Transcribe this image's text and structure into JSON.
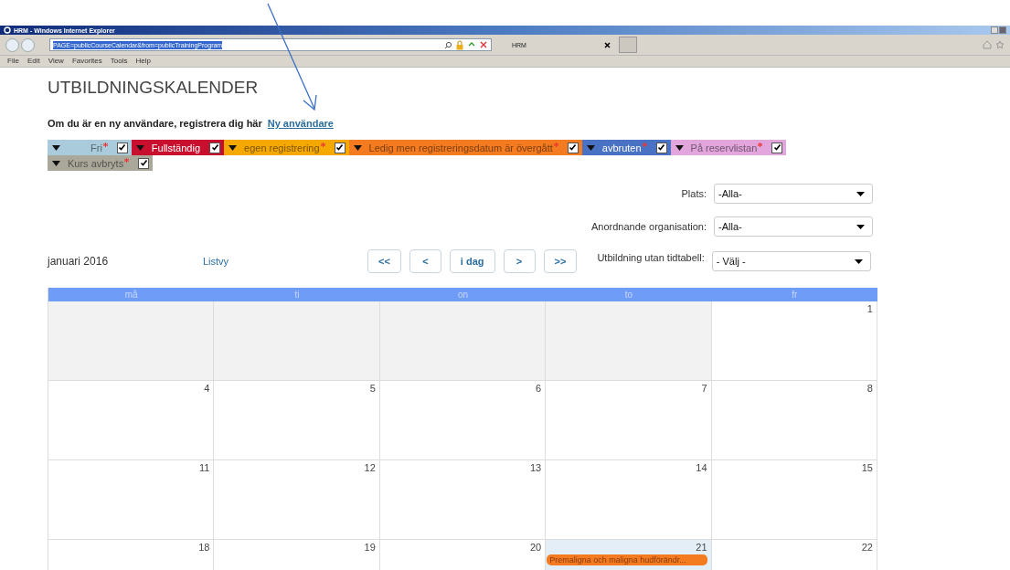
{
  "window": {
    "title": "HRM - Windows Internet Explorer"
  },
  "browser": {
    "address": "PAGE=publicCourseCalendar&from=publicTrainingProgram",
    "tab": "HRM",
    "menu": [
      "File",
      "Edit",
      "View",
      "Favorites",
      "Tools",
      "Help"
    ]
  },
  "page": {
    "title": "UTBILDNINGSKALENDER",
    "register_text": "Om du är en ny användare, registrera dig här",
    "register_link": "Ny användare"
  },
  "legend": [
    {
      "label": "Fri",
      "required": true,
      "checked": true,
      "color": "#a9cbdb"
    },
    {
      "label": "Fullständig",
      "required": false,
      "checked": true,
      "color": "#c8102e"
    },
    {
      "label": "egen registrering",
      "required": true,
      "checked": true,
      "color": "#f5a800"
    },
    {
      "label": "Ledig men registreringsdatum är övergått",
      "required": true,
      "checked": true,
      "color": "#f47b20"
    },
    {
      "label": "avbruten",
      "required": true,
      "checked": true,
      "color": "#4a72c4"
    },
    {
      "label": "På reservlistan",
      "required": true,
      "checked": true,
      "color": "#e2a6dc"
    },
    {
      "label": "Kurs avbryts",
      "required": true,
      "checked": true,
      "color": "#aaa79b"
    }
  ],
  "filters": [
    {
      "label": "Plats:",
      "value": "-Alla-"
    },
    {
      "label": "Anordnande organisation:",
      "value": "-Alla-"
    },
    {
      "label": "Utbildning utan tidtabell:",
      "value": "- Välj -"
    }
  ],
  "month": "januari 2016",
  "list_view": "Listvy",
  "nav_buttons": [
    "<<",
    "<",
    "i dag",
    ">",
    ">>"
  ],
  "weekdays": [
    "må",
    "ti",
    "on",
    "to",
    "fr"
  ],
  "weeks": [
    {
      "days": [
        {
          "in_month": false
        },
        {
          "in_month": false
        },
        {
          "in_month": false
        },
        {
          "in_month": false
        },
        {
          "day": "1",
          "in_month": true
        }
      ]
    },
    {
      "days": [
        {
          "day": "4",
          "in_month": true
        },
        {
          "day": "5",
          "in_month": true
        },
        {
          "day": "6",
          "in_month": true
        },
        {
          "day": "7",
          "in_month": true
        },
        {
          "day": "8",
          "in_month": true
        }
      ]
    },
    {
      "days": [
        {
          "day": "11",
          "in_month": true
        },
        {
          "day": "12",
          "in_month": true
        },
        {
          "day": "13",
          "in_month": true
        },
        {
          "day": "14",
          "in_month": true
        },
        {
          "day": "15",
          "in_month": true
        }
      ]
    },
    {
      "days": [
        {
          "day": "18",
          "in_month": true
        },
        {
          "day": "19",
          "in_month": true
        },
        {
          "day": "20",
          "in_month": true
        },
        {
          "day": "21",
          "in_month": true,
          "today": true,
          "events": [
            {
              "title": "Premaligna och maligna hudförändr...",
              "color": "#f47b20"
            }
          ]
        },
        {
          "day": "22",
          "in_month": true
        }
      ]
    }
  ]
}
